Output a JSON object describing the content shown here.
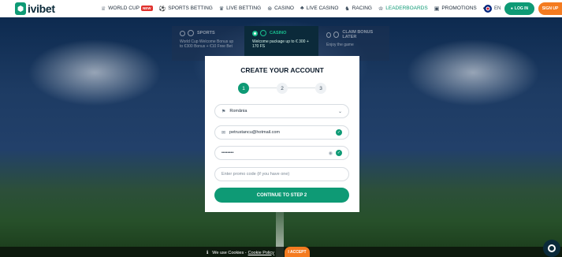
{
  "header": {
    "logo_text": "ivibet",
    "nav": [
      {
        "label": "WORLD CUP",
        "icon": "trophy-icon",
        "badge": "NEW"
      },
      {
        "label": "SPORTS BETTING",
        "icon": "ball-icon"
      },
      {
        "label": "LIVE BETTING",
        "icon": "live-icon"
      },
      {
        "label": "CASINO",
        "icon": "chip-icon"
      },
      {
        "label": "LIVE CASINO",
        "icon": "cards-icon"
      },
      {
        "label": "RACING",
        "icon": "horse-icon"
      },
      {
        "label": "LEADERBOARDS",
        "icon": "crown-icon"
      },
      {
        "label": "PROMOTIONS",
        "icon": "gift-icon"
      }
    ],
    "more_label": "•••",
    "language": "EN",
    "login_label": "LOG IN",
    "signup_label": "SIGN UP"
  },
  "bonus_tabs": {
    "sports": {
      "title": "SPORTS",
      "desc": "World Cup Welcome Bonus up to €300 Bonus + €10 Free Bet"
    },
    "casino": {
      "title": "CASINO",
      "desc": "Welcome package up to € 300 + 170 FS"
    },
    "claim": {
      "title": "CLAIM BONUS LATER",
      "desc": "Enjoy the game"
    }
  },
  "modal": {
    "title": "CREATE YOUR ACCOUNT",
    "steps": [
      "1",
      "2",
      "3"
    ],
    "country": "România",
    "email": "petrustancu@hotmail.com",
    "password": "••••••••",
    "promo_placeholder": "Enter promo code (if you have one)",
    "continue_label": "CONTINUE TO STEP 2"
  },
  "cookie": {
    "text": "We use Cookies -",
    "link": "Cookie Policy",
    "accept_label": "I ACCEPT"
  },
  "colors": {
    "brand_green": "#0e9a75",
    "accent_orange": "#f47b20"
  }
}
